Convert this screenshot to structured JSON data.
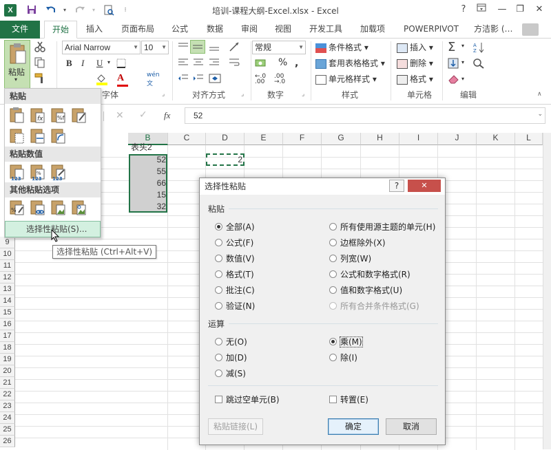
{
  "window": {
    "title": "培训-课程大纲-Excel.xlsx - Excel",
    "app_icon": "X",
    "help": "?",
    "minimize": "—",
    "restore": "❐",
    "close": "✕"
  },
  "tabs": [
    "文件",
    "开始",
    "插入",
    "页面布局",
    "公式",
    "数据",
    "审阅",
    "视图",
    "开发工具",
    "加载项",
    "POWERPIVOT",
    "方洁影 (…"
  ],
  "ribbon": {
    "paste_label": "粘贴",
    "font_name": "Arial Narrow",
    "font_size": "10",
    "number_format": "常规",
    "groups": {
      "font": "字体",
      "alignment": "对齐方式",
      "number": "数字",
      "styles": "样式",
      "cells": "单元格",
      "editing": "编辑"
    },
    "styles_items": [
      "条件格式",
      "套用表格格式",
      "单元格样式"
    ],
    "cells_items": [
      "插入",
      "删除",
      "格式"
    ]
  },
  "formula_bar": {
    "name_box": "",
    "fx": "fx",
    "value": "52"
  },
  "columns": [
    "B",
    "C",
    "D",
    "E",
    "F",
    "G",
    "H",
    "I",
    "J",
    "K",
    "L"
  ],
  "rows": [
    "9",
    "10",
    "11",
    "12",
    "13",
    "14",
    "15",
    "16",
    "17",
    "18",
    "19",
    "20",
    "21",
    "22",
    "23",
    "24",
    "25",
    "26"
  ],
  "cells": {
    "b1": "表头2",
    "b2": "52",
    "b3": "55",
    "b4": "66",
    "b5": "15",
    "b6": "32",
    "d2": "2"
  },
  "paste_menu": {
    "section1": "粘贴",
    "section2": "粘贴数值",
    "section3": "其他粘贴选项",
    "special_link": "选择性粘贴(S)..."
  },
  "tooltip": "选择性粘贴 (Ctrl+Alt+V)",
  "dialog": {
    "title": "选择性粘贴",
    "help": "?",
    "close": "✕",
    "paste_section": "粘贴",
    "paste_left": [
      "全部(A)",
      "公式(F)",
      "数值(V)",
      "格式(T)",
      "批注(C)",
      "验证(N)"
    ],
    "paste_right": [
      "所有使用源主题的单元(H)",
      "边框除外(X)",
      "列宽(W)",
      "公式和数字格式(R)",
      "值和数字格式(U)",
      "所有合并条件格式(G)"
    ],
    "op_section": "运算",
    "op_left": [
      "无(O)",
      "加(D)",
      "减(S)"
    ],
    "op_right": [
      "乘(M)",
      "除(I)"
    ],
    "skip_blanks": "跳过空单元(B)",
    "transpose": "转置(E)",
    "paste_link": "粘贴链接(L)",
    "ok": "确定",
    "cancel": "取消"
  }
}
